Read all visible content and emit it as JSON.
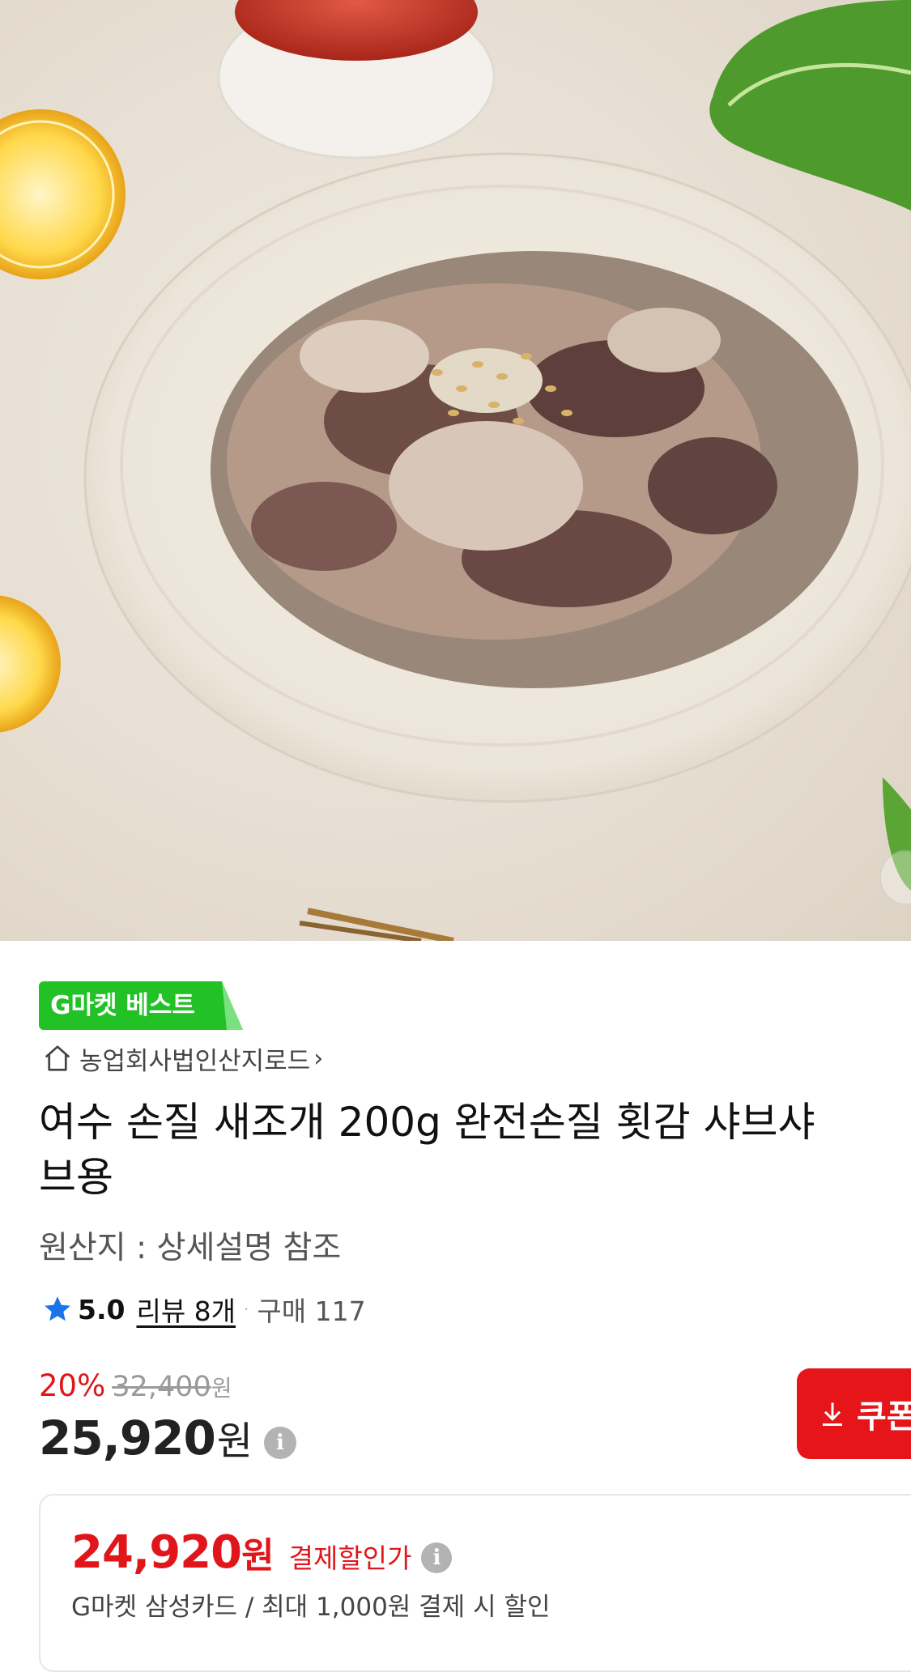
{
  "hero": {
    "image_alt": "새조개 회 접시"
  },
  "badge": {
    "label": "G마켓 베스트"
  },
  "store": {
    "name": "농업회사법인산지로드",
    "chevron": "›"
  },
  "product": {
    "title_line1": "여수 손질 새조개 200g 완전손질 횟감 샤브샤",
    "title_line2": "브용",
    "origin": "원산지 : 상세설명 참조"
  },
  "rating": {
    "score": "5.0",
    "review": "리뷰 8개",
    "separator": "·",
    "purchase": "구매 117"
  },
  "price": {
    "discount_rate": "20%",
    "original": "32,400",
    "original_unit": "원",
    "sale": "25,920",
    "sale_unit": "원",
    "info": "i"
  },
  "coupon": {
    "label": "쿠폰"
  },
  "card_discount": {
    "amount": "24,920",
    "unit": "원",
    "label": "결제할인가",
    "info": "i",
    "description": "G마켓 삼성카드 / 최대 1,000원 결제 시 할인"
  },
  "colors": {
    "accent_red": "#e0161b",
    "badge_green": "#22c227",
    "star_blue": "#1a73e8"
  },
  "icons": [
    "home-icon",
    "chevron-right-icon",
    "star-icon",
    "info-icon",
    "download-icon"
  ]
}
